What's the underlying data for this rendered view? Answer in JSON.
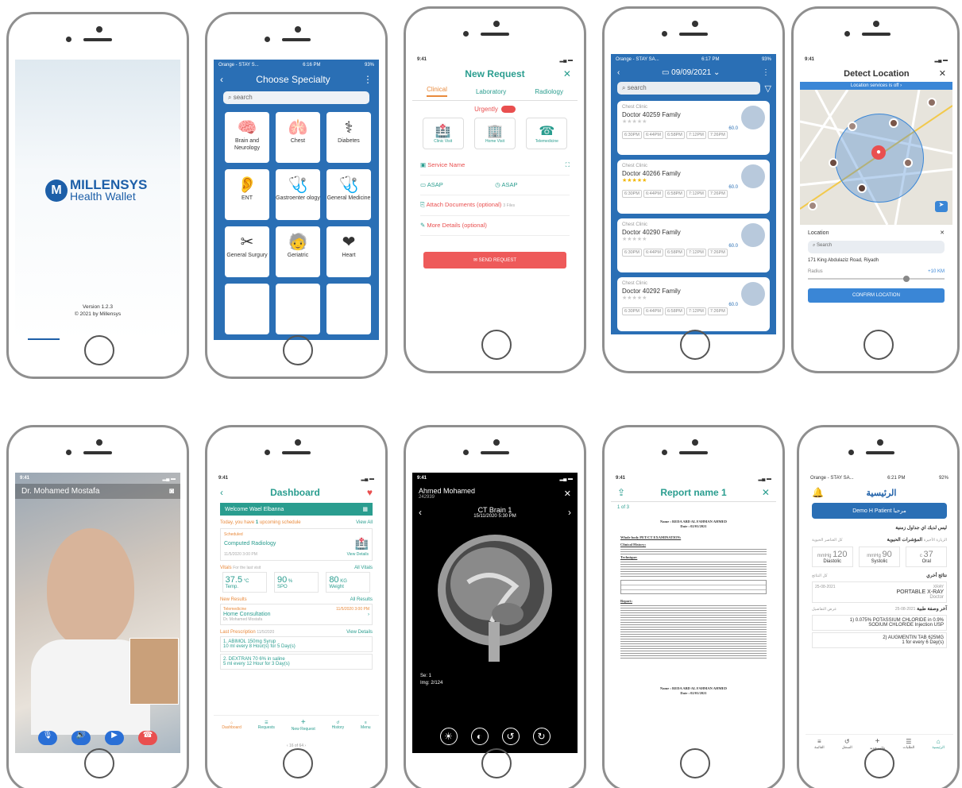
{
  "splash": {
    "brand": "MILLENSYS",
    "brand_sub": "Health Wallet",
    "version": "Version 1.2.3",
    "copyright": "© 2021 by Millensys"
  },
  "specialty": {
    "status_carrier": "Orange - STAY S...",
    "status_time": "6:16 PM",
    "status_batt": "93%",
    "title": "Choose Specialty",
    "search": "search",
    "items": [
      "Brain and Neurology",
      "Chest",
      "Diabetes",
      "ENT",
      "Gastroenter ology",
      "General Medicine",
      "General Surgury",
      "Geriatric",
      "Heart"
    ]
  },
  "new_request": {
    "time": "9:41",
    "title": "New Request",
    "tabs": [
      "Clinical",
      "Laboratory",
      "Radiology"
    ],
    "urgency": "Urgently",
    "visits": [
      "Clinic Visit",
      "Home Visit",
      "Telemedicine"
    ],
    "service": "Service Name",
    "asap1": "ASAP",
    "asap2": "ASAP",
    "attach": "Attach Documents (optional)",
    "attach_note": "3 Files",
    "details": "More Details (optional)",
    "send": "SEND REQUEST"
  },
  "doctors": {
    "status_carrier": "Orange - STAY SA...",
    "status_time": "6:17 PM",
    "status_batt": "93%",
    "date": "09/09/2021",
    "search": "search",
    "cards": [
      {
        "clinic": "Chest Clinic",
        "name": "Doctor 40259 Family",
        "price": "60.0"
      },
      {
        "clinic": "Chest Clinic",
        "name": "Doctor 40266 Family",
        "price": "60.0"
      },
      {
        "clinic": "Chest Clinic",
        "name": "Doctor 40290 Family",
        "price": "60.0"
      },
      {
        "clinic": "Chest Clinic",
        "name": "Doctor 40292 Family",
        "price": "60.0"
      }
    ],
    "slots": [
      "6:30PM",
      "6:44PM",
      "6:58PM",
      "7:12PM",
      "7:26PM"
    ]
  },
  "location": {
    "time": "9:41",
    "title": "Detect Location",
    "banner": "Location services is off",
    "label": "Location",
    "search": "Search",
    "address": "171 King Abdulaziz Road, Riyadh",
    "radius": "Radius",
    "radius_val": "+10 KM",
    "radius_level": 0.7,
    "confirm": "CONFIRM LOCATION"
  },
  "video": {
    "time": "9:41",
    "doctor": "Dr. Mohamed Mostafa"
  },
  "dashboard": {
    "time": "9:41",
    "title": "Dashboard",
    "welcome": "Welcome Wael Elbanna",
    "today_pre": "Today, you have ",
    "today_num": "1",
    "today_post": " upcoming schedule",
    "view_all": "View All",
    "sched_tag": "Scheduled",
    "sched_name": "Computed Radiology",
    "sched_date": "11/5/2020 3:00 PM",
    "view_details": "View Details",
    "vitals": "Vitals",
    "vitals_sub": "For the last visit",
    "all_vitals": "All Vitals",
    "v_temp": "37.5",
    "v_temp_u": "°C",
    "v_temp_l": "Temp.",
    "v_spo": "90",
    "v_spo_u": "%",
    "v_spo_l": "SPO",
    "v_weight": "80",
    "v_weight_u": "KG",
    "v_weight_l": "Weight",
    "new_results": "New Results",
    "all_results": "All Results",
    "res_type": "Telemedicine",
    "res_date": "11/5/2020 3:00 PM",
    "res_name": "Home Consultation",
    "res_doc": "Dr. Mohamed Mostafa",
    "last_rx": "Last Prescription",
    "rx_date": "11/5/2020",
    "rx_view": "View Details",
    "rx1": "1. ABIMOL 150mg Syrup",
    "rx1b": "10 ml every 8 Hour(s) for 5 Day(s)",
    "rx2": "2. DEXTRAN 70 6% in saline",
    "rx2b": "5 ml every 12 Hour for 3 Day(s)",
    "nav": [
      "Dashboard",
      "Requests",
      "New Request",
      "History",
      "Menu"
    ],
    "pager": "16 of 64"
  },
  "ct": {
    "time": "9:41",
    "patient": "Ahmed Mohamed",
    "pid": "242939",
    "study": "CT Brain 1",
    "date": "15/11/2020 5:30 PM",
    "se": "Se: 1",
    "img": "Img: 2/124"
  },
  "report": {
    "time": "9:41",
    "title": "Report name 1",
    "page": "1 of 3",
    "name_line": "Name : REDA ABD AL FAHMAN AHMED",
    "date_line": "Date : 02/01/2021",
    "heading": "Whole body PET/CT EXAMINATION:",
    "history": "Clinical History:",
    "technique": "Technique:",
    "report_h": "Report:"
  },
  "arabic": {
    "status_carrier": "Orange - STAY SA...",
    "status_time": "6:21 PM",
    "status_batt": "92%",
    "title": "الرئيسية",
    "patient": "Demo H Patient",
    "patient_pre": "مرحبا",
    "no_sched": "ليس لديك اي جداول زمنية",
    "vitals": "المؤشرات الحيوية",
    "vitals_sub": "الزيارة الأخيرة",
    "vitals_all": "كل العناصر الحيوية",
    "d_val": "120",
    "d_unit": "mmHg",
    "d_lbl": "Diastolic",
    "s_val": "90",
    "s_unit": "mmHg",
    "s_lbl": "Systolic",
    "t_val": "37",
    "t_unit": "c",
    "t_lbl": "Oral",
    "others": "نتائج أخري",
    "others_all": "كل النتائج",
    "xray_date": "25-08-2021",
    "xray_tag": "XRAY",
    "xray_name": "PORTABLE X-RAY",
    "xray_doc": "Doctor",
    "rx": "آخر وصفة طبية",
    "rx_date": "25-08-2021",
    "rx_show": "عرض التفاصيل",
    "rx1": "1) 0.075% POTASSIUM CHLORIDE in 0.9%",
    "rx1b": "SODIUM CHLORIDE Injection USP",
    "rx2": "2) AUGMENTIN TAB 625MG",
    "rx2b": "1 for every 6 Day(s)",
    "nav": [
      "القائمة",
      "السجل",
      "طلب جديد",
      "الطلبات",
      "الرئيسية"
    ]
  },
  "colors": {
    "teal": "#2a9d8f",
    "blue": "#2a6fb5",
    "red": "#e94f4f",
    "dark": "#000"
  }
}
